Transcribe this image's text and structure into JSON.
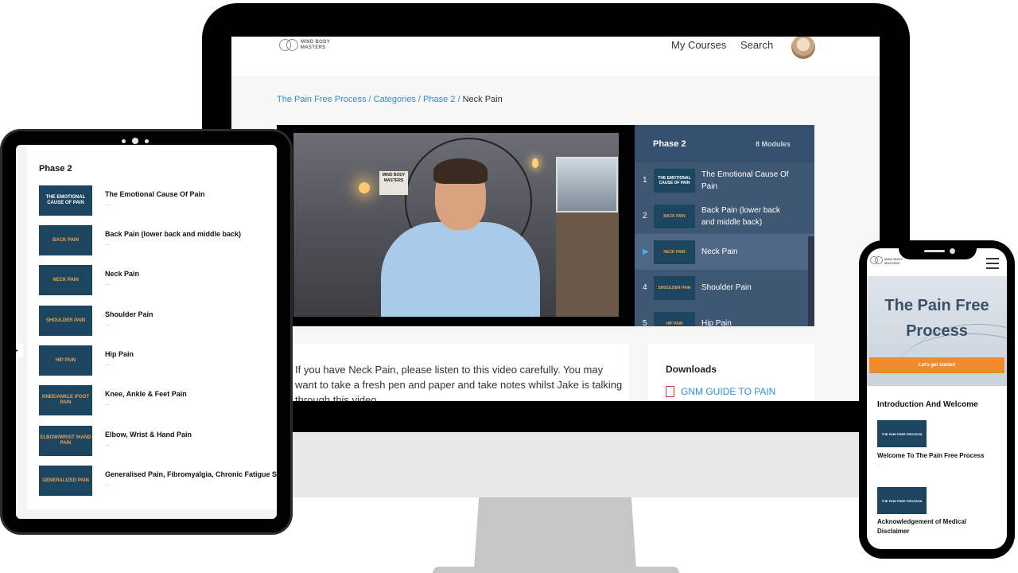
{
  "desktop": {
    "logo": {
      "line1": "MIND BODY",
      "line2": "MASTERS"
    },
    "nav": {
      "my_courses": "My Courses",
      "search": "Search"
    },
    "breadcrumb": {
      "course": "The Pain Free Process",
      "sep": " / ",
      "categories": "Categories",
      "phase": "Phase 2",
      "current": "Neck Pain"
    },
    "video_sign": "MIND BODY MASTERS",
    "playlist": {
      "title": "Phase 2",
      "modules": "8 Modules",
      "items": [
        {
          "num": "1",
          "thumb": "THE EMOTIONAL CAUSE OF PAIN",
          "label": "The Emotional Cause Of Pain"
        },
        {
          "num": "2",
          "thumb": "BACK PAIN",
          "label": "Back Pain (lower back and middle back)"
        },
        {
          "num": "",
          "thumb": "NECK PAIN",
          "label": "Neck Pain"
        },
        {
          "num": "4",
          "thumb": "SHOULDER PAIN",
          "label": "Shoulder Pain"
        },
        {
          "num": "5",
          "thumb": "HIP PAIN",
          "label": "Hip Pain"
        }
      ]
    },
    "description": "If you have Neck Pain, please listen to this video carefully. You may want to take a fresh pen and paper and take notes whilst Jake is talking through this video.",
    "downloads": {
      "title": "Downloads",
      "file": "GNM GUIDE TO PAIN"
    }
  },
  "tablet": {
    "title": "Phase 2",
    "dots": "...",
    "items": [
      {
        "thumb": "THE EMOTIONAL CAUSE OF PAIN",
        "label": "The Emotional Cause Of Pain"
      },
      {
        "thumb": "BACK PAIN",
        "label": "Back Pain (lower back and middle back)"
      },
      {
        "thumb": "NECK PAIN",
        "label": "Neck Pain"
      },
      {
        "thumb": "SHOULDER PAIN",
        "label": "Shoulder Pain"
      },
      {
        "thumb": "HIP PAIN",
        "label": "Hip Pain"
      },
      {
        "thumb": "KNEE/ANKLE /FOOT PAIN",
        "label": "Knee, Ankle & Feet Pain"
      },
      {
        "thumb": "ELBOW/WRIST /HAND PAIN",
        "label": "Elbow, Wrist & Hand Pain"
      },
      {
        "thumb": "GENERALIZED PAIN",
        "label": "Generalised Pain, Fibromyalgia, Chronic Fatigue Sy"
      }
    ]
  },
  "phone": {
    "logo": {
      "line1": "MIND BODY",
      "line2": "MASTERS"
    },
    "hero_title": "The Pain Free Process",
    "cta": "Let's get started",
    "section": "Introduction And Welcome",
    "dots": "...",
    "lessons": [
      {
        "thumb": "THE PAIN FREE PROCESS",
        "label": "Welcome To The Pain Free Process"
      },
      {
        "thumb": "THE PAIN FREE PROCESS",
        "label": "Acknowledgement of Medical Disclaimer"
      }
    ]
  }
}
